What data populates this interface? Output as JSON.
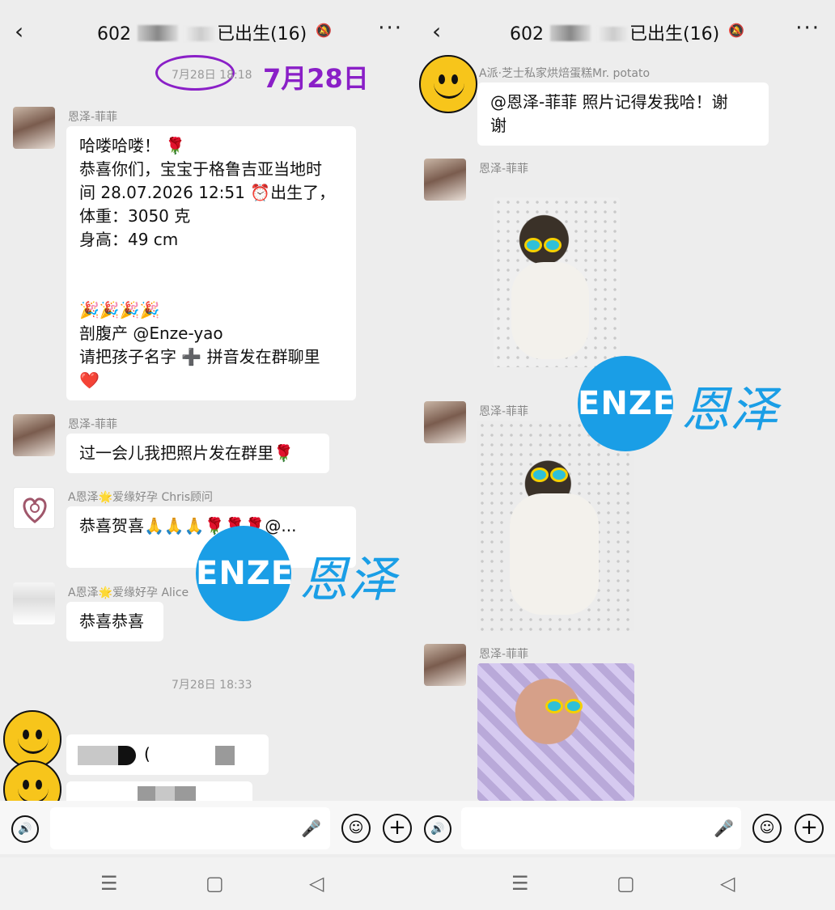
{
  "left": {
    "title_prefix": "602",
    "title_suffix": "已出生(16)",
    "date_time_1": "7月28日 18:18",
    "big_date": "7月28日",
    "messages": [
      {
        "sender": "恩泽-菲菲",
        "lines": [
          "哈喽哈喽！ 🌹",
          "恭喜你们，宝宝于格鲁吉亚当地时",
          "间 28.07.2026 12:51 ⏰出生了，",
          "体重：3050 克",
          "身高：49 cm",
          "",
          "",
          "🎉🎉🎉🎉",
          "剖腹产 @Enze-yao",
          "请把孩子名字 ➕ 拼音发在群聊里",
          "❤️"
        ]
      },
      {
        "sender": "恩泽-菲菲",
        "lines": [
          "过一会儿我把照片发在群里🌹"
        ]
      },
      {
        "sender": "A恩泽🌟爱缘好孕 Chris顾问",
        "lines": [
          "恭喜贺喜🙏🙏🙏🌹🌹🌹@..."
        ]
      },
      {
        "sender": "A恩泽🌟爱缘好孕 Alice",
        "lines": [
          "恭喜恭喜"
        ]
      }
    ],
    "date_time_2": "7月28日 18:33",
    "redacted_paren": "("
  },
  "right": {
    "title_prefix": "602",
    "title_suffix": "已出生(16)",
    "sender_top": "A派·芝士私家烘焙蛋糕Mr. potato",
    "msg_top_lines": [
      "@恩泽-菲菲  照片记得发我哈！谢",
      "谢"
    ],
    "photo_senders": [
      "恩泽-菲菲",
      "恩泽-菲菲",
      "恩泽-菲菲"
    ]
  },
  "watermark": {
    "disc_text": "ENZE",
    "cn_text": "恩泽"
  },
  "icons": {
    "back": "‹",
    "more": "···",
    "mute": "🔕",
    "voice": "🔊",
    "mic": "🎤",
    "emoji": "☺",
    "plus": "+",
    "nav_menu": "☰",
    "nav_home": "▢",
    "nav_back": "◁"
  },
  "colors": {
    "accent_purple": "#8a1fc7",
    "watermark_blue": "#1a9ee6",
    "smiley_yellow": "#f7c51b"
  }
}
